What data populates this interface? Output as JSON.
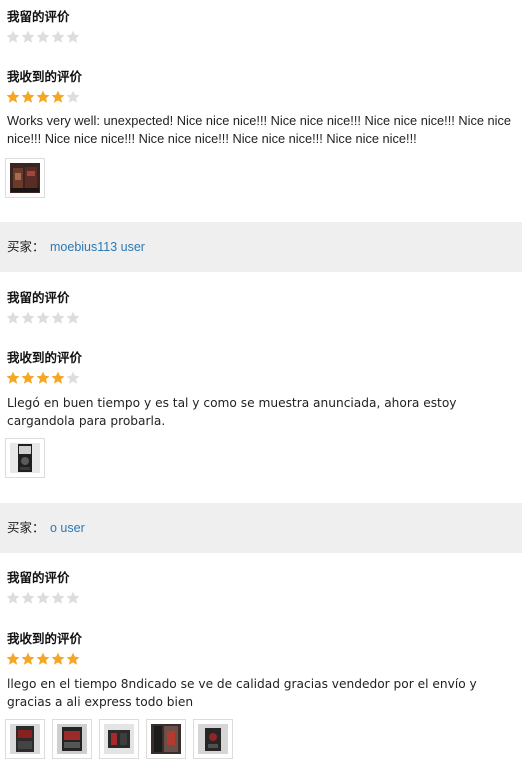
{
  "labels": {
    "my_left_review": "我留的评价",
    "my_received_review": "我收到的评价",
    "buyer_prefix": "买家："
  },
  "colors": {
    "star_filled": "#f5a623",
    "star_empty": "#dddddd",
    "buyer_name": "#2a78b4",
    "buyer_bar_bg": "#efefef"
  },
  "reviews": [
    {
      "buyer_name": "",
      "left_rating": 0,
      "received_rating": 4,
      "text": "Works very well: unexpected! Nice nice nice!!! Nice nice nice!!! Nice nice nice!!! Nice nice nice!!! Nice nice nice!!! Nice nice nice!!! Nice nice nice!!! Nice nice nice!!!",
      "photo_count": 1
    },
    {
      "buyer_name": "moebius113 user",
      "left_rating": 0,
      "received_rating": 4,
      "text": "Llegó en buen tiempo y es tal y como se muestra anunciada, ahora estoy cargandola para probarla.",
      "photo_count": 1
    },
    {
      "buyer_name": "o user",
      "left_rating": 0,
      "received_rating": 5,
      "text": "llego en el tiempo 8ndicado se ve de calidad gracias vendedor por el envío y gracias a ali express todo bien",
      "photo_count": 5
    }
  ]
}
